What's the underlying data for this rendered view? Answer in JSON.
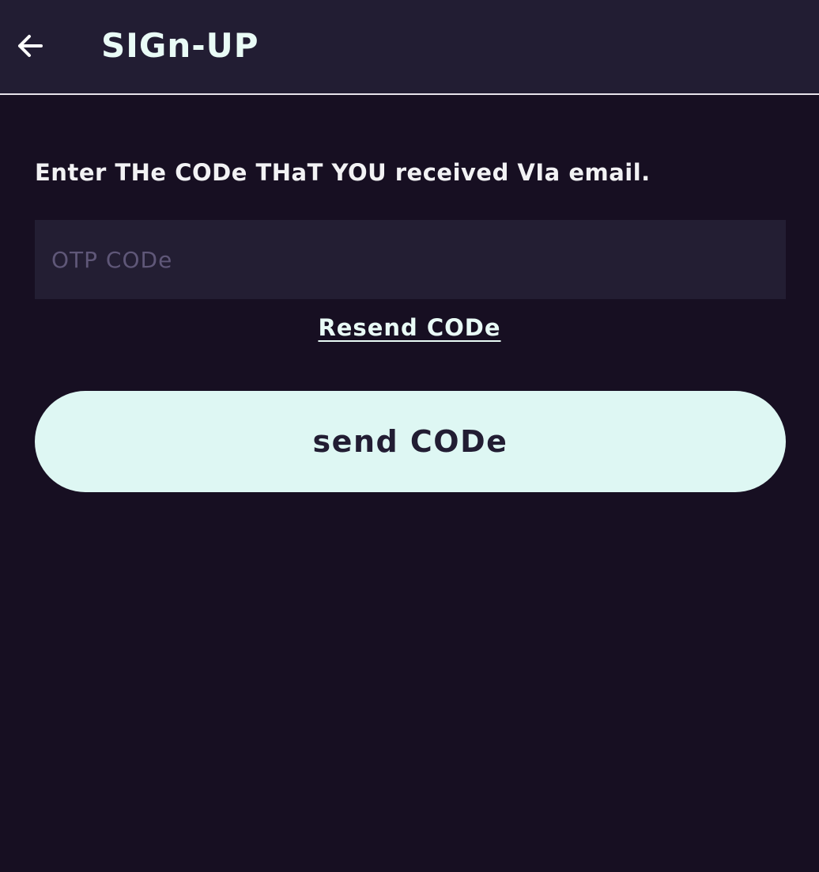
{
  "header": {
    "back_icon": "arrow-left-icon",
    "title": "SIGn-UP"
  },
  "form": {
    "instruction": "Enter THe CODe THaT YOU received VIa email.",
    "otp_placeholder": "OTP CODe",
    "otp_value": "",
    "resend_label": "Resend CODe",
    "submit_label": "send CODe"
  },
  "colors": {
    "background": "#170f22",
    "app_bar": "#221d33",
    "input_bg": "#231e33",
    "accent": "#def7f3",
    "placeholder": "#5f5778"
  }
}
